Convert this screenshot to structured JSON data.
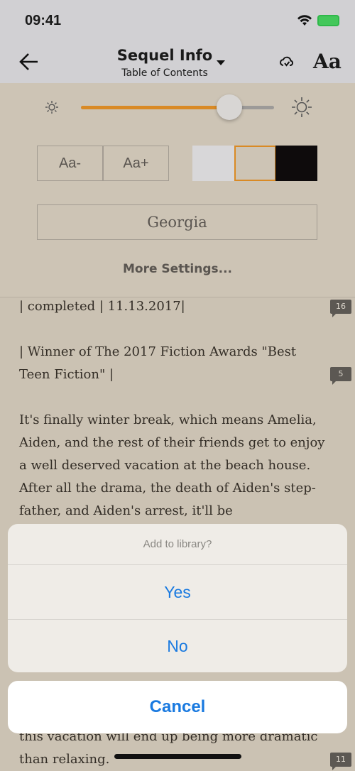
{
  "status_bar": {
    "time": "09:41"
  },
  "nav": {
    "title": "Sequel Info",
    "subtitle": "Table of Contents"
  },
  "settings": {
    "brightness_percent": 77,
    "font_decrease": "Aa-",
    "font_increase": "Aa+",
    "themes": [
      {
        "name": "white",
        "color": "#d8d7d9"
      },
      {
        "name": "sepia",
        "color": "#cdc4b5",
        "selected": true
      },
      {
        "name": "dark",
        "color": "#0e0b0c"
      }
    ],
    "font_name": "Georgia",
    "more_settings": "More Settings...",
    "accent": "#d98a25"
  },
  "content": {
    "paragraphs": [
      {
        "text": "| completed |  11.13.2017|",
        "comments": "16"
      },
      {
        "text": "| Winner of The 2017 Fiction Awards \"Best Teen Fiction\" |",
        "comments": "5"
      },
      {
        "text": "It's finally winter break, which means Amelia, Aiden, and the rest of their friends get to enjoy a well deserved vacation at the beach house. After all the drama, the death of Aiden's step-father, and Aiden's arrest, it'll be"
      }
    ],
    "tail_lines": [
      "this vacation will end up being more dramatic",
      "than relaxing."
    ],
    "tail_comments": "11"
  },
  "action_sheet": {
    "title": "Add to library?",
    "yes": "Yes",
    "no": "No",
    "cancel": "Cancel",
    "button_color": "#1a7ae0"
  }
}
